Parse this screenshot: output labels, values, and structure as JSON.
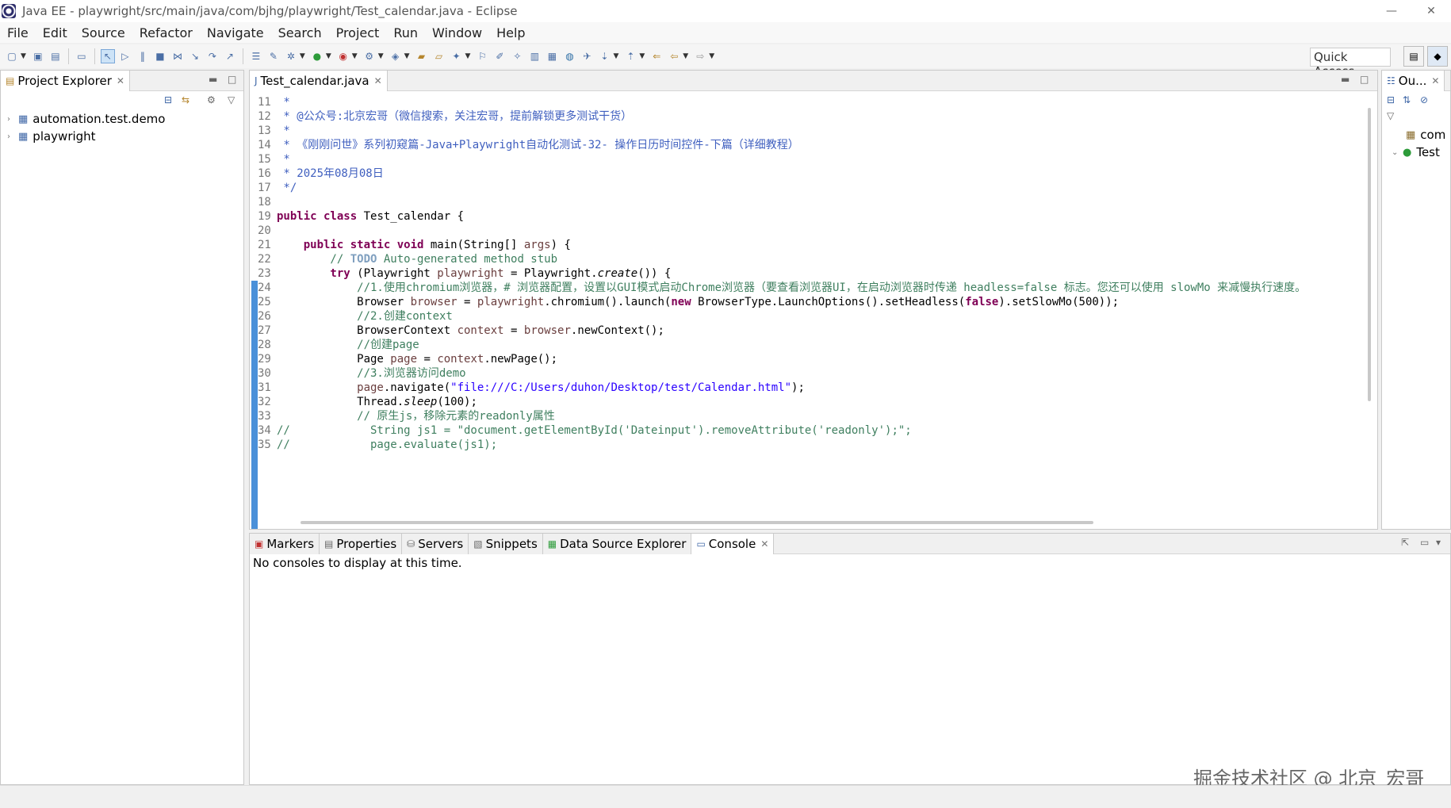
{
  "window": {
    "title": "Java EE - playwright/src/main/java/com/bjhg/playwright/Test_calendar.java - Eclipse",
    "minimize": "—",
    "close": "✕"
  },
  "menu": [
    "File",
    "Edit",
    "Source",
    "Refactor",
    "Navigate",
    "Search",
    "Project",
    "Run",
    "Window",
    "Help"
  ],
  "toolbar": {
    "quick_access": "Quick Access"
  },
  "project_explorer": {
    "title": "Project Explorer",
    "items": [
      {
        "label": "automation.test.demo"
      },
      {
        "label": "playwright"
      }
    ]
  },
  "editor": {
    "tab_label": "Test_calendar.java",
    "lines": [
      {
        "n": "11"
      },
      {
        "n": "12"
      },
      {
        "n": "13"
      },
      {
        "n": "14"
      },
      {
        "n": "15"
      },
      {
        "n": "16"
      },
      {
        "n": "17"
      },
      {
        "n": "18"
      },
      {
        "n": "19"
      },
      {
        "n": "20"
      },
      {
        "n": "21"
      },
      {
        "n": "22"
      },
      {
        "n": "23"
      },
      {
        "n": "24"
      },
      {
        "n": "25"
      },
      {
        "n": "26"
      },
      {
        "n": "27"
      },
      {
        "n": "28"
      },
      {
        "n": "29"
      },
      {
        "n": "30"
      },
      {
        "n": "31"
      },
      {
        "n": "32"
      },
      {
        "n": "33"
      },
      {
        "n": "34"
      },
      {
        "n": "35"
      }
    ],
    "code": {
      "l11": " *",
      "l12": " * @公众号:北京宏哥（微信搜索，关注宏哥，提前解锁更多测试干货）",
      "l13": " *",
      "l14": " * 《刚刚问世》系列初窥篇-Java+Playwright自动化测试-32- 操作日历时间控件-下篇（详细教程）",
      "l15": " *",
      "l16": " * 2025年08月08日",
      "l17": " */",
      "l19_kw": "public class",
      "l19_rest": " Test_calendar {",
      "l21_kw": "    public static void",
      "l21_a": " main(String[] ",
      "l21_v": "args",
      "l21_b": ") {",
      "l22_a": "        // ",
      "l22_todo": "TODO",
      "l22_b": " Auto-generated method stub",
      "l23_kw": "        try",
      "l23_a": " (Playwright ",
      "l23_v": "playwright",
      "l23_b": " = Playwright.",
      "l23_m": "create",
      "l23_c": "()) {",
      "l24": "            //1.使用chromium浏览器，# 浏览器配置，设置以GUI模式启动Chrome浏览器（要查看浏览器UI，在启动浏览器时传递 headless=false 标志。您还可以使用 slowMo 来减慢执行速度。",
      "l25_a": "            Browser ",
      "l25_v": "browser",
      "l25_b": " = ",
      "l25_v2": "playwright",
      "l25_c": ".chromium().launch(",
      "l25_kw": "new",
      "l25_d": " BrowserType.LaunchOptions().setHeadless(",
      "l25_kw2": "false",
      "l25_e": ").setSlowMo(500));",
      "l26": "            //2.创建context",
      "l27_a": "            BrowserContext ",
      "l27_v": "context",
      "l27_b": " = ",
      "l27_v2": "browser",
      "l27_c": ".newContext();",
      "l28": "            //创建page",
      "l29_a": "            Page ",
      "l29_v": "page",
      "l29_b": " = ",
      "l29_v2": "context",
      "l29_c": ".newPage();",
      "l30": "            //3.浏览器访问demo",
      "l31_v": "            page",
      "l31_a": ".navigate(",
      "l31_s": "\"file:///C:/Users/duhon/Desktop/test/Calendar.html\"",
      "l31_b": ");",
      "l32_a": "            Thread.",
      "l32_m": "sleep",
      "l32_b": "(100);",
      "l33": "            // 原生js，移除元素的readonly属性",
      "l34": "//            String js1 = \"document.getElementById('Dateinput').removeAttribute('readonly');\";",
      "l35": "//            page.evaluate(js1);"
    }
  },
  "outline": {
    "tab_label": "Ou...",
    "items": [
      {
        "label": "com"
      },
      {
        "label": "Test"
      }
    ]
  },
  "bottom_panel": {
    "tabs": [
      {
        "label": "Markers",
        "icon": "markers-icon"
      },
      {
        "label": "Properties",
        "icon": "properties-icon"
      },
      {
        "label": "Servers",
        "icon": "servers-icon"
      },
      {
        "label": "Snippets",
        "icon": "snippets-icon"
      },
      {
        "label": "Data Source Explorer",
        "icon": "datasource-icon"
      },
      {
        "label": "Console",
        "icon": "console-icon"
      }
    ],
    "message": "No consoles to display at this time."
  },
  "watermark": "掘金技术社区 @ 北京_宏哥"
}
